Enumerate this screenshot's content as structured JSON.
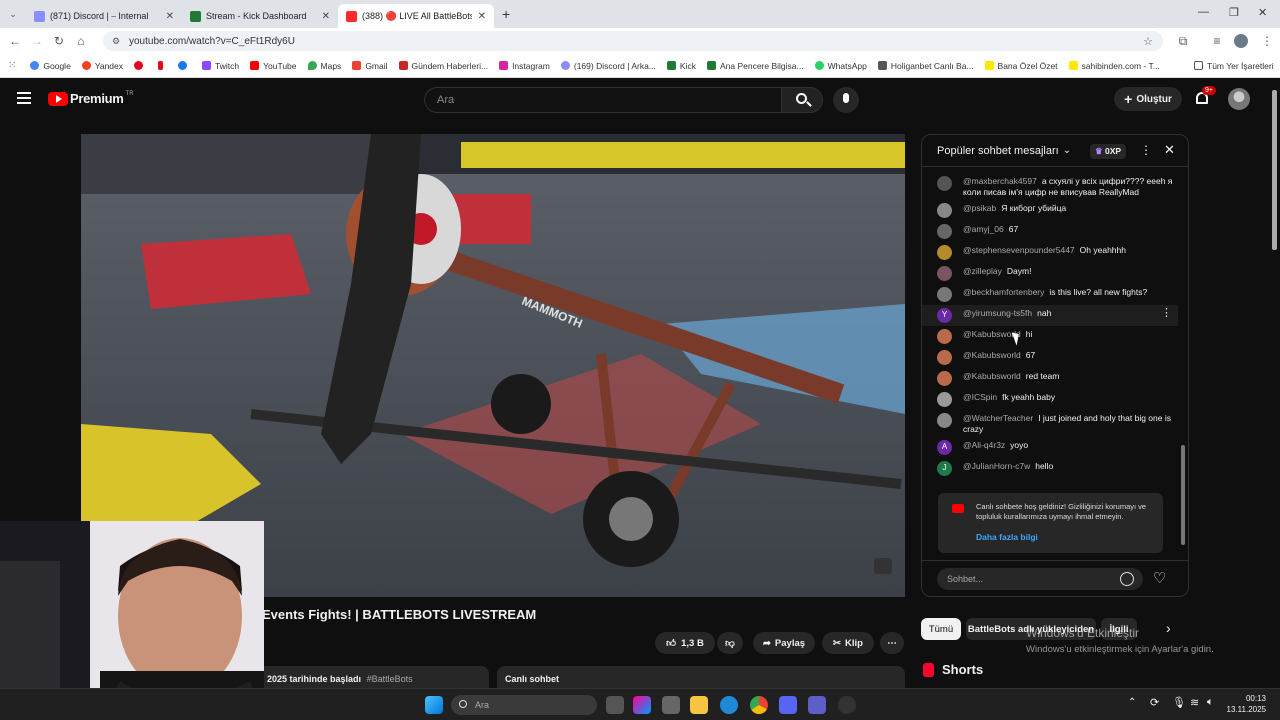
{
  "browser": {
    "tabs": [
      {
        "title": "(871) Discord | ⎯ Internal",
        "favicon": "#8a8dff",
        "active": false
      },
      {
        "title": "Stream - Kick Dashboard",
        "favicon": "#1e7a35",
        "active": false
      },
      {
        "title": "(388) 🔴 LIVE All BattleBots",
        "favicon": "#ff2b2b",
        "active": true
      }
    ],
    "new_tab": "+",
    "url": "youtube.com/watch?v=C_eFt1Rdy6U",
    "bookmarks": [
      "Google",
      "Yandex",
      "",
      "",
      "",
      "Twitch",
      "YouTube",
      "Maps",
      "Gmail",
      "Gündem Haberleri...",
      "Instagram",
      "(169) Discord | Arka...",
      "Kick",
      "Ana Pencere Bilgisa...",
      "WhatsApp",
      "Holiganbet Canlı Ba...",
      "Bana Özel Özet",
      "sahibinden.com - T..."
    ],
    "all_bookmarks": "Tüm Yer İşaretleri"
  },
  "youtube": {
    "logo": "Premium",
    "logo_tr": "TR",
    "search_placeholder": "Ara",
    "create_label": "Oluştur",
    "notif_count": "9+",
    "video_title": "Events Fights! | BATTLEBOTS LIVESTREAM",
    "likes": "1,3 B",
    "share": "Paylaş",
    "clip": "Klip",
    "started": "i 2025 tarihinde başladı",
    "hashtag": "#BattleBots",
    "live_chat_label": "Canlı sohbet"
  },
  "chat": {
    "header": "Popüler sohbet mesajları",
    "xp": "0XP",
    "messages": [
      {
        "author": "@maxberchak4597",
        "text": "а схуялі у всіх цифри???? еееh я коли писав ім'я цифр не вписував ReallyMad",
        "avatar_color": "#555",
        "initial": ""
      },
      {
        "author": "@psikab",
        "text": "Я киборг убийца",
        "avatar_color": "#888",
        "initial": ""
      },
      {
        "author": "@amyj_06",
        "text": "67",
        "avatar_color": "#666",
        "initial": ""
      },
      {
        "author": "@stephensevenpounder5447",
        "text": "Oh yeahhhh",
        "avatar_color": "#b58a2a",
        "initial": ""
      },
      {
        "author": "@zilleplay",
        "text": "Daym!",
        "avatar_color": "#7a5560",
        "initial": ""
      },
      {
        "author": "@beckhamfortenbery",
        "text": "is this live? all new fights?",
        "avatar_color": "#777",
        "initial": ""
      },
      {
        "author": "@yirumsung-ts5fh",
        "text": "nah",
        "avatar_color": "#6a2aa8",
        "initial": "Y"
      },
      {
        "author": "@Kabubsworld",
        "text": "hi",
        "avatar_color": "#b86a4a",
        "initial": ""
      },
      {
        "author": "@Kabubsworld",
        "text": "67",
        "avatar_color": "#b86a4a",
        "initial": ""
      },
      {
        "author": "@Kabubsworld",
        "text": "red team",
        "avatar_color": "#b86a4a",
        "initial": ""
      },
      {
        "author": "@ICSpin",
        "text": "fk yeahh baby",
        "avatar_color": "#999",
        "initial": ""
      },
      {
        "author": "@WatcherTeacher",
        "text": "I just joined and holy that big one is crazy",
        "avatar_color": "#888",
        "initial": ""
      },
      {
        "author": "@Ali-q4r3z",
        "text": "yoyo",
        "avatar_color": "#6a2aa8",
        "initial": "A"
      },
      {
        "author": "@JulianHorn-c7w",
        "text": "hello",
        "avatar_color": "#1e7a4a",
        "initial": "J"
      }
    ],
    "system_notice": "Canlı sohbete hoş geldiniz! Gizliliğinizi korumayı ve topluluk kurallarımıza uymayı ihmal etmeyin.",
    "system_link": "Daha fazla bilgi",
    "input_placeholder": "Sohbet..."
  },
  "below": {
    "chips": [
      "Tümü",
      "BattleBots adlı yükleyiciden",
      "İlgili"
    ],
    "shorts": "Shorts",
    "activate_title": "Windows'u Etkinleştir",
    "activate_sub": "Windows'u etkinleştirmek için Ayarlar'a gidin."
  },
  "taskbar": {
    "search": "Ara",
    "time": "00:13",
    "date": "13.11.2025"
  },
  "video_overlay": {
    "robot_name": "MAMMOTH"
  }
}
